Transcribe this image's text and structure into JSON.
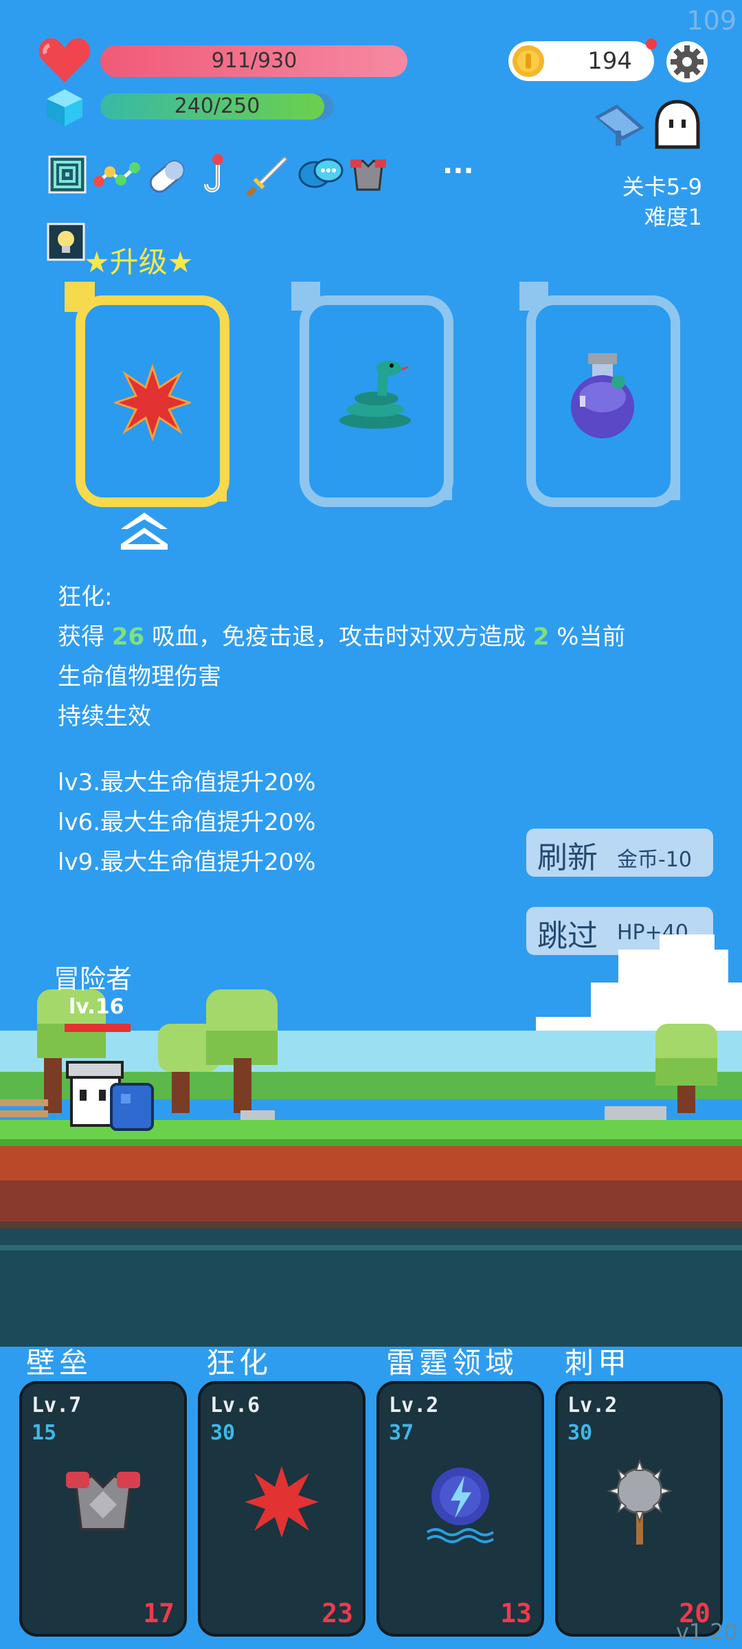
{
  "fps": "109",
  "hud": {
    "hp_text": "911/930",
    "hp_ratio": 0.98,
    "mp_text": "240/250",
    "mp_ratio": 0.96,
    "coins": "194",
    "stage": "关卡5-9",
    "difficulty": "难度1"
  },
  "buffs": [
    "target-icon",
    "molecule-icon",
    "pill-icon",
    "hook-icon",
    "sword-icon",
    "speech-icon",
    "armor-icon"
  ],
  "more_label": "···",
  "upgrade": {
    "title_prefix": "★",
    "title": "升级",
    "title_suffix": "★"
  },
  "cards": [
    {
      "name": "berserk-card",
      "icon": "splat-icon",
      "selected": true
    },
    {
      "name": "snake-card",
      "icon": "snake-icon",
      "selected": false
    },
    {
      "name": "potion-card",
      "icon": "potion-icon",
      "selected": false
    }
  ],
  "description": {
    "name": "狂化:",
    "line1_a": "获得",
    "value1": "26",
    "line1_b": "吸血，免疫击退，攻击时对双方造成",
    "value2": "2",
    "line1_c": "%当前",
    "line2": "生命值物理伤害",
    "line3": "持续生效",
    "lv3": "lv3.最大生命值提升20%",
    "lv6": "lv6.最大生命值提升20%",
    "lv9": "lv9.最大生命值提升20%"
  },
  "buttons": {
    "refresh": "刷新",
    "refresh_cost": "金币-10",
    "skip": "跳过",
    "skip_reward": "HP+40"
  },
  "player": {
    "title": "冒险者",
    "level": "lv.16",
    "hp_ratio": 0.98
  },
  "skills": [
    {
      "name": "壁垒",
      "lv": "Lv.7",
      "num": "15",
      "count": "17",
      "icon": "armor-icon"
    },
    {
      "name": "狂化",
      "lv": "Lv.6",
      "num": "30",
      "count": "23",
      "icon": "splat-icon"
    },
    {
      "name": "雷霆领域",
      "lv": "Lv.2",
      "num": "37",
      "count": "13",
      "icon": "thunder-icon"
    },
    {
      "name": "刺甲",
      "lv": "Lv.2",
      "num": "30",
      "count": "20",
      "icon": "spiked-mace-icon"
    }
  ],
  "version": "v1.20",
  "colors": {
    "accent": "#f7d94e",
    "background": "#2e9df0",
    "hp": "#f05a78",
    "mp": "#6cd04c"
  }
}
